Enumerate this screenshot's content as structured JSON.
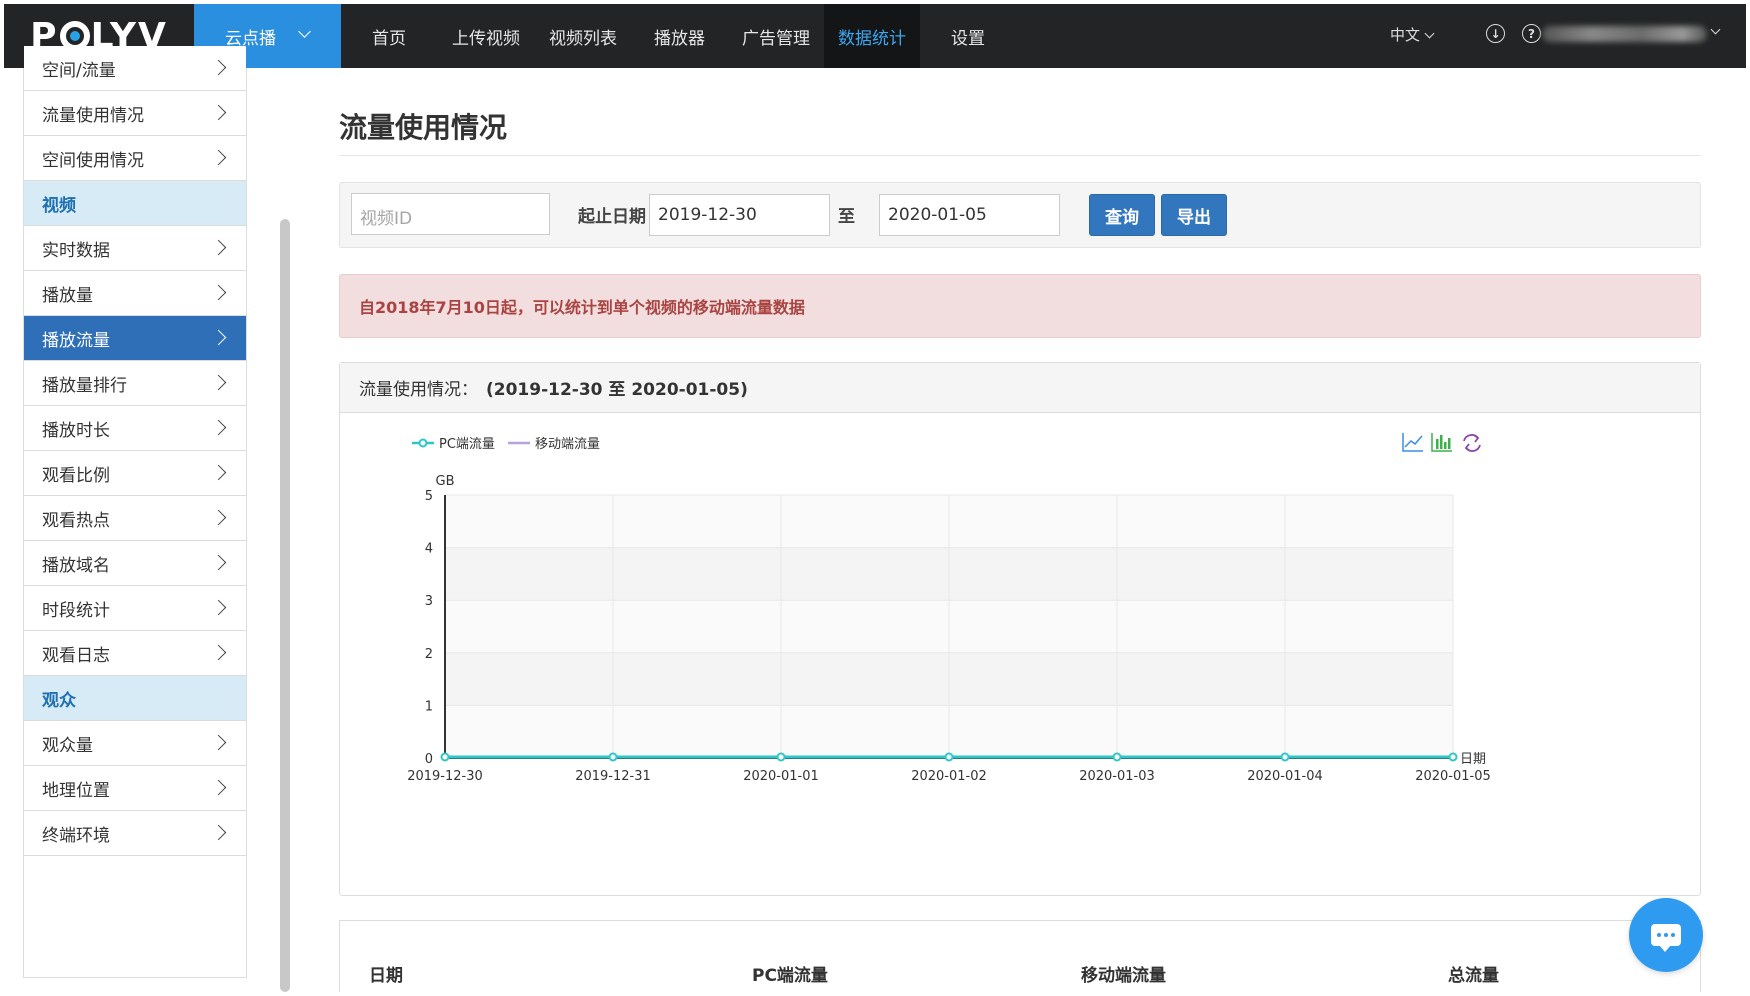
{
  "brand": {
    "logo_text_left": "P",
    "logo_text_right": "LYV"
  },
  "topbar": {
    "product_label": "云点播",
    "nav": [
      "首页",
      "上传视频",
      "视频列表",
      "播放器",
      "广告管理",
      "数据统计",
      "设置"
    ],
    "active_nav": "数据统计",
    "language": "中文",
    "download_icon": "download-icon",
    "help_icon": "help-icon"
  },
  "sidebar": {
    "items": [
      {
        "label": "空间/流量",
        "type": "item"
      },
      {
        "label": "流量使用情况",
        "type": "item"
      },
      {
        "label": "空间使用情况",
        "type": "item"
      },
      {
        "label": "视频",
        "type": "section"
      },
      {
        "label": "实时数据",
        "type": "item"
      },
      {
        "label": "播放量",
        "type": "item"
      },
      {
        "label": "播放流量",
        "type": "active"
      },
      {
        "label": "播放量排行",
        "type": "item"
      },
      {
        "label": "播放时长",
        "type": "item"
      },
      {
        "label": "观看比例",
        "type": "item"
      },
      {
        "label": "观看热点",
        "type": "item"
      },
      {
        "label": "播放域名",
        "type": "item"
      },
      {
        "label": "时段统计",
        "type": "item"
      },
      {
        "label": "观看日志",
        "type": "item"
      },
      {
        "label": "观众",
        "type": "section"
      },
      {
        "label": "观众量",
        "type": "item"
      },
      {
        "label": "地理位置",
        "type": "item"
      },
      {
        "label": "终端环境",
        "type": "item"
      }
    ]
  },
  "page": {
    "title": "流量使用情况",
    "filter": {
      "video_id_placeholder": "视频ID",
      "date_label": "起止日期",
      "start_date": "2019-12-30",
      "to_label": "至",
      "end_date": "2020-01-05",
      "query_button": "查询",
      "export_button": "导出"
    },
    "alert": "自2018年7月10日起，可以统计到单个视频的移动端流量数据",
    "panel": {
      "heading": "流量使用情况：",
      "range": "(2019-12-30 至 2020-01-05)"
    },
    "table": {
      "headers": [
        "日期",
        "PC端流量",
        "移动端流量",
        "总流量"
      ]
    }
  },
  "chart_data": {
    "type": "line",
    "x": [
      "2019-12-30",
      "2019-12-31",
      "2020-01-01",
      "2020-01-02",
      "2020-01-03",
      "2020-01-04",
      "2020-01-05"
    ],
    "series": [
      {
        "name": "PC端流量",
        "values": [
          0,
          0,
          0,
          0,
          0,
          0,
          0
        ],
        "color": "#2ec7c9"
      },
      {
        "name": "移动端流量",
        "values": [
          0,
          0,
          0,
          0,
          0,
          0,
          0
        ],
        "color": "#b6a2de"
      }
    ],
    "ylabel": "GB",
    "xlabel": "日期",
    "ylim": [
      0,
      5
    ],
    "yticks": [
      0,
      1,
      2,
      3,
      4,
      5
    ],
    "grid": true,
    "legend": "top-left",
    "toolbox": [
      "line-chart-icon",
      "bar-chart-icon",
      "refresh-icon"
    ]
  }
}
